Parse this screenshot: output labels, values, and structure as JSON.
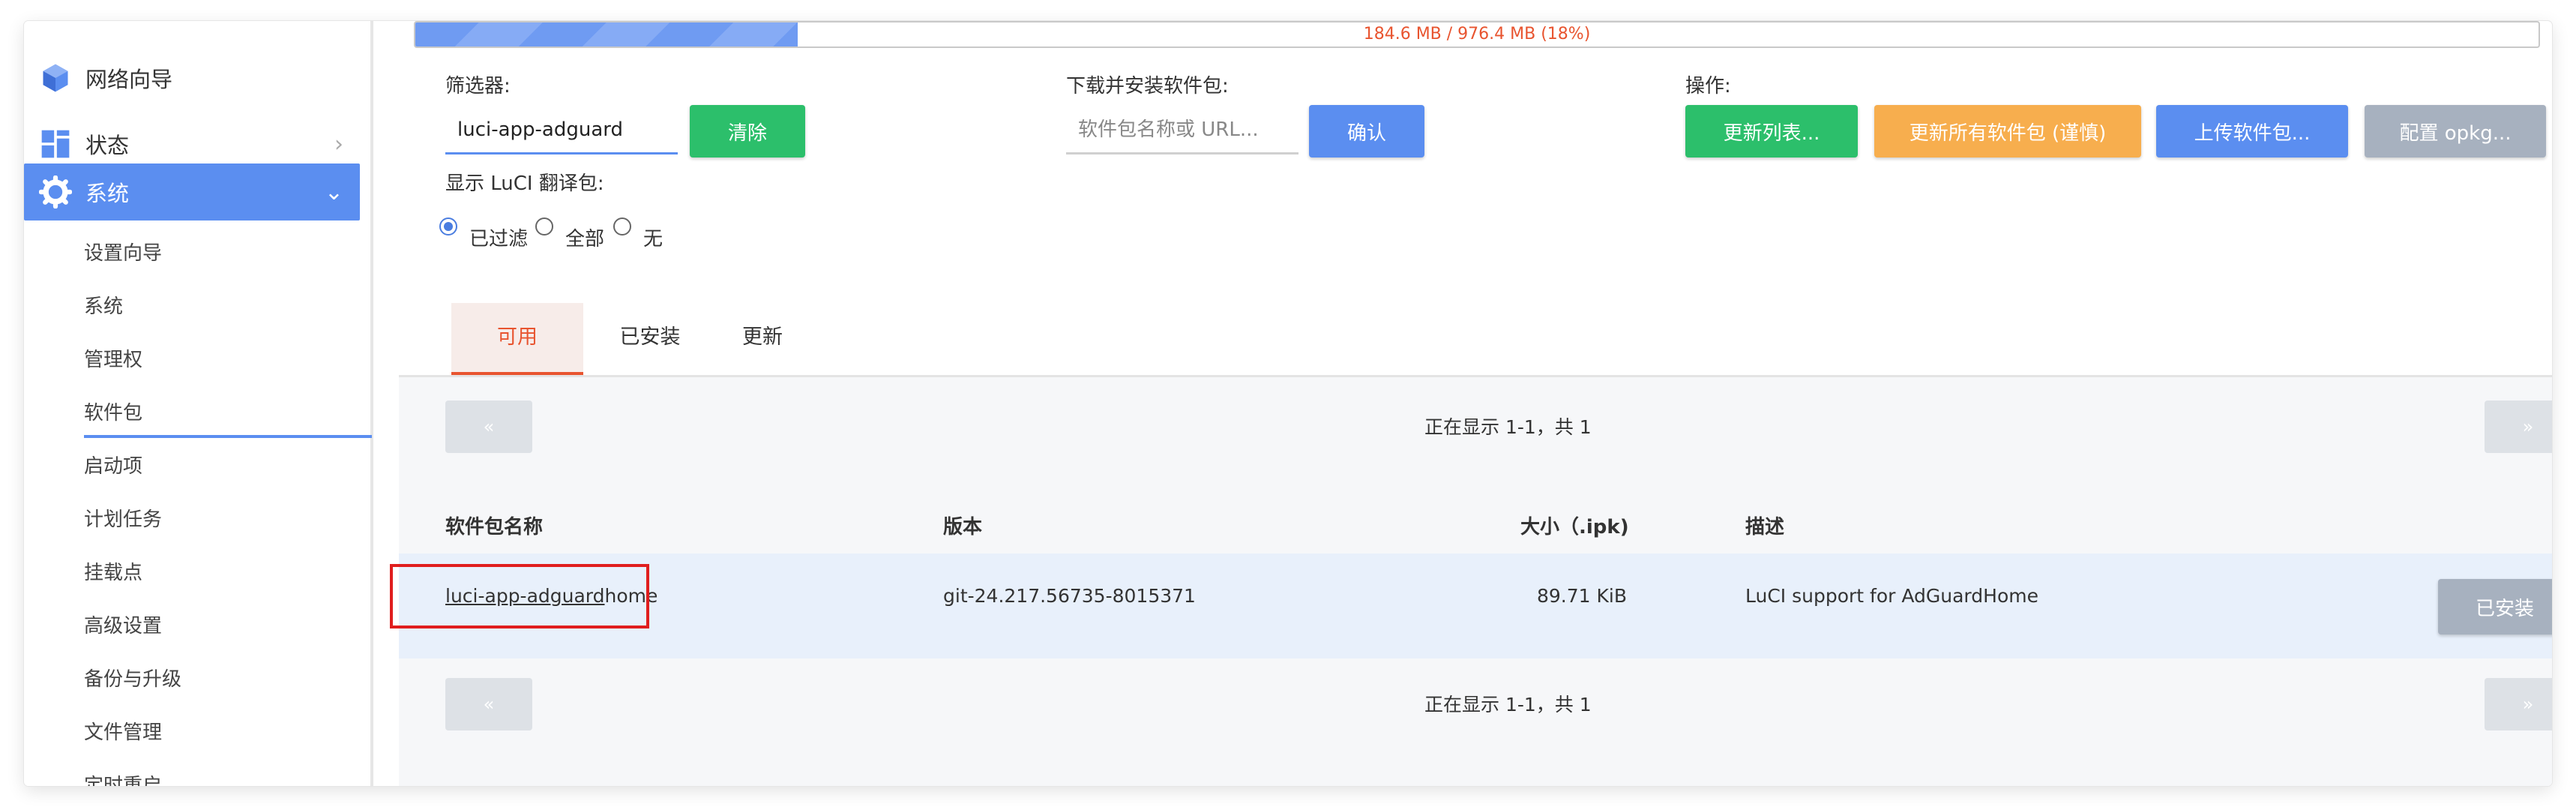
{
  "sidebar": {
    "top_items": [
      {
        "label": "网络向导",
        "icon": "cube-icon"
      },
      {
        "label": "状态",
        "icon": "grid-icon"
      },
      {
        "label": "系统",
        "icon": "gear-icon"
      }
    ],
    "sub_items": [
      "设置向导",
      "系统",
      "管理权",
      "软件包",
      "启动项",
      "计划任务",
      "挂载点",
      "高级设置",
      "备份与升级",
      "文件管理",
      "定时重启"
    ],
    "active_sub": "软件包"
  },
  "disk": {
    "text": "184.6 MB / 976.4 MB (18%)",
    "fraction": 0.18
  },
  "filter": {
    "label": "筛选器:",
    "value": "luci-app-adguard",
    "clear_label": "清除"
  },
  "download": {
    "label": "下载并安装软件包:",
    "placeholder": "软件包名称或 URL...",
    "confirm_label": "确认"
  },
  "actions": {
    "label": "操作:",
    "update_lists": "更新列表...",
    "upgrade_all": "更新所有软件包 (谨慎)",
    "upload": "上传软件包...",
    "configure": "配置 opkg..."
  },
  "translation": {
    "label": "显示 LuCI 翻译包:",
    "options": [
      "已过滤",
      "全部",
      "无"
    ],
    "selected": "已过滤"
  },
  "tabs": [
    "可用",
    "已安装",
    "更新"
  ],
  "pager": {
    "prev": "«",
    "next": "»",
    "text": "正在显示 1-1，共 1"
  },
  "table": {
    "headers": [
      "软件包名称",
      "版本",
      "大小（.ipk)",
      "描述"
    ],
    "rows": [
      {
        "name_match": "luci-app-adguard",
        "name_rest": "home",
        "version": "git-24.217.56735-8015371",
        "size": "89.71 KiB",
        "description": "LuCI support for AdGuardHome",
        "action": "已安装"
      }
    ]
  },
  "colors": {
    "accent": "#5b8ef0",
    "active_tab": "#e8542f",
    "green": "#2cbf6b",
    "orange": "#f7ae4e",
    "highlight_box": "#e01e1e"
  }
}
